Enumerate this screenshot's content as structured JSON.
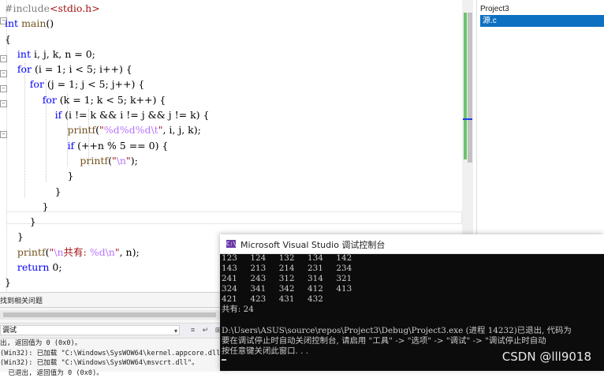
{
  "editor": {
    "lines": [
      "#include<stdio.h>",
      "int main()",
      "{",
      "    int i, j, k, n = 0;",
      "    for (i = 1; i < 5; i++) {",
      "        for (j = 1; j < 5; j++) {",
      "            for (k = 1; k < 5; k++) {",
      "                if (i != k && i != j && j != k) {",
      "                    printf(\"%d%d%d\\t\", i, j, k);",
      "                    if (++n % 5 == 0) {",
      "                        printf(\"\\n\");",
      "                    }",
      "                }",
      "            }",
      "        }",
      "    }",
      "    printf(\"\\n共有: %d\\n\", n);",
      "    return 0;",
      "}"
    ]
  },
  "solution_explorer": {
    "project": "Project3",
    "file": "源.c"
  },
  "output_panel": {
    "tab_label": "找到相关问题",
    "source_select": "调试",
    "lines": [
      "出, 返回值为 0 (0x0)。",
      "(Win32): 已加载 \"C:\\Windows\\SysWOW64\\kernel.appcore.dll\"。",
      "(Win32): 已加载 \"C:\\Windows\\SysWOW64\\msvcrt.dll\"。",
      "  已退出, 返回值为 0 (0x0)。"
    ]
  },
  "console": {
    "title": "Microsoft Visual Studio 调试控制台",
    "icon_label": "C:\\",
    "lines": [
      "123     124     132     134     142",
      "143     213     214     231     234",
      "241     243     312     314     321",
      "324     341     342     412     413",
      "421     423     431     432",
      "共有: 24",
      "",
      "D:\\Users\\ASUS\\source\\repos\\Project3\\Debug\\Project3.exe (进程 14232)已退出, 代码为",
      "要在调试停止时自动关闭控制台, 请启用 \"工具\" -> \"选项\" -> \"调试\" -> \"调试停止时自动",
      "按任意键关闭此窗口. . ."
    ]
  },
  "watermark": "CSDN @lll9018",
  "colors": {
    "keyword": "#0000ff",
    "string": "#a31515",
    "selection": "#0e70c0",
    "console_bg": "#0c0c0c"
  }
}
